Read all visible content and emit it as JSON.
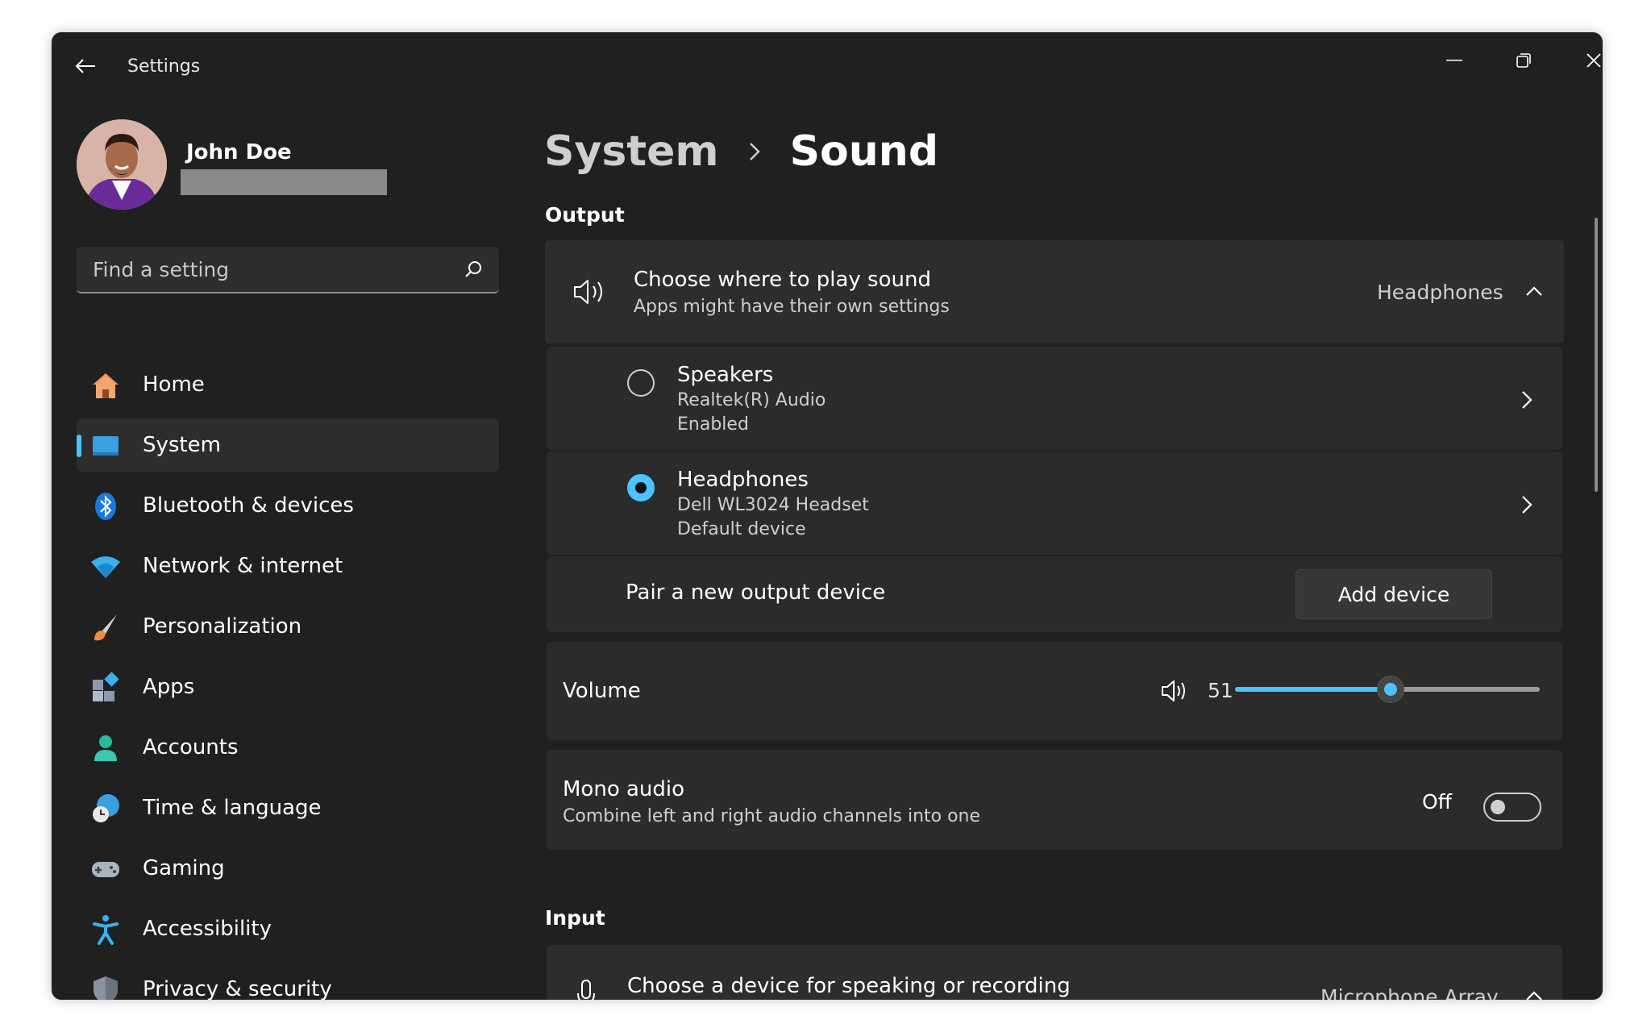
{
  "window": {
    "title": "Settings",
    "accent": "#4cc2ff"
  },
  "user": {
    "name": "John Doe"
  },
  "search": {
    "placeholder": "Find a setting"
  },
  "nav": {
    "items": [
      {
        "label": "Home",
        "icon": "home-icon"
      },
      {
        "label": "System",
        "icon": "system-icon",
        "active": true
      },
      {
        "label": "Bluetooth & devices",
        "icon": "bluetooth-icon"
      },
      {
        "label": "Network & internet",
        "icon": "wifi-icon"
      },
      {
        "label": "Personalization",
        "icon": "brush-icon"
      },
      {
        "label": "Apps",
        "icon": "apps-icon"
      },
      {
        "label": "Accounts",
        "icon": "accounts-icon"
      },
      {
        "label": "Time & language",
        "icon": "globe-clock-icon"
      },
      {
        "label": "Gaming",
        "icon": "gamepad-icon"
      },
      {
        "label": "Accessibility",
        "icon": "accessibility-icon"
      },
      {
        "label": "Privacy & security",
        "icon": "shield-icon"
      }
    ]
  },
  "breadcrumb": {
    "parent": "System",
    "current": "Sound"
  },
  "output": {
    "heading": "Output",
    "choose": {
      "title": "Choose where to play sound",
      "subtitle": "Apps might have their own settings",
      "selected": "Headphones"
    },
    "devices": [
      {
        "name": "Speakers",
        "driver": "Realtek(R) Audio",
        "status": "Enabled",
        "selected": false
      },
      {
        "name": "Headphones",
        "driver": "Dell WL3024 Headset",
        "status": "Default device",
        "selected": true
      }
    ],
    "pair": {
      "label": "Pair a new output device",
      "button": "Add device"
    },
    "volume": {
      "label": "Volume",
      "value": "51",
      "fraction": 0.51
    },
    "mono": {
      "title": "Mono audio",
      "subtitle": "Combine left and right audio channels into one",
      "state": "Off",
      "on": false
    }
  },
  "input": {
    "heading": "Input",
    "choose": {
      "title": "Choose a device for speaking or recording",
      "selected": "Microphone Array"
    }
  }
}
